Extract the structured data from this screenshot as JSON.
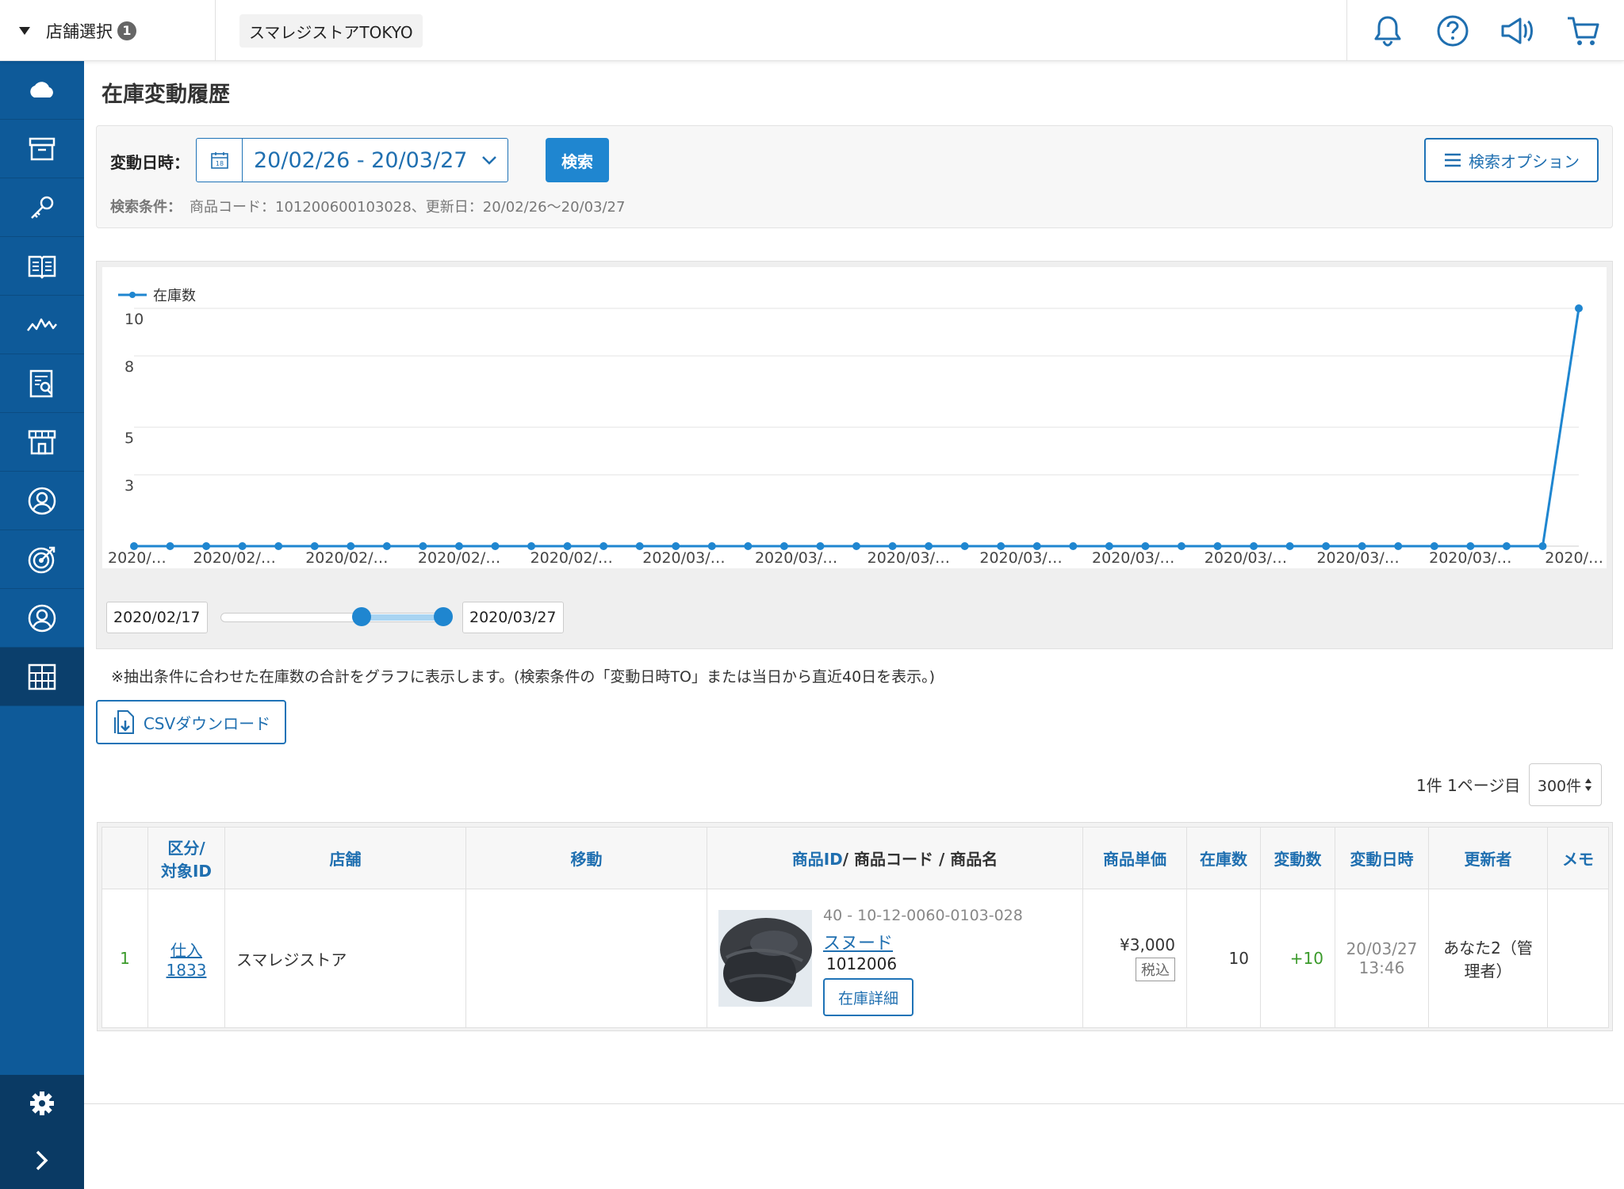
{
  "header": {
    "store_select_label": "店舗選択",
    "store_count": "1",
    "current_store": "スマレジストアTOKYO"
  },
  "page": {
    "title": "在庫変動履歴"
  },
  "search": {
    "date_label": "変動日時：",
    "date_range": "20/02/26 - 20/03/27",
    "search_button": "検索",
    "options_button": "検索オプション",
    "conditions_label": "検索条件：",
    "conditions_text": "商品コード：101200600103028、更新日：20/02/26〜20/03/27"
  },
  "chart_data": {
    "type": "line",
    "legend": [
      "在庫数"
    ],
    "legend_placement": "top-left",
    "grid": true,
    "ylim": [
      0,
      10
    ],
    "yticks": [
      "3",
      "5",
      "8",
      "10"
    ],
    "xtick_labels": [
      "2020/…",
      "2020/02/…",
      "2020/02/…",
      "2020/02/…",
      "2020/02/…",
      "2020/03/…",
      "2020/03/…",
      "2020/03/…",
      "2020/03/…",
      "2020/03/…",
      "2020/03/…",
      "2020/03/…",
      "2020/03/…",
      "2020/…"
    ],
    "series": [
      {
        "name": "在庫数",
        "color": "#1f86d0",
        "values": [
          0,
          0,
          0,
          0,
          0,
          0,
          0,
          0,
          0,
          0,
          0,
          0,
          0,
          0,
          0,
          0,
          0,
          0,
          0,
          0,
          0,
          0,
          0,
          0,
          0,
          0,
          0,
          0,
          0,
          0,
          0,
          0,
          0,
          0,
          0,
          0,
          0,
          0,
          0,
          0,
          10
        ]
      }
    ]
  },
  "range": {
    "from": "2020/02/17",
    "to": "2020/03/27",
    "selected_start_fraction": 0.62,
    "selected_end_fraction": 1.0
  },
  "note": "※抽出条件に合わせた在庫数の合計をグラフに表示します。(検索条件の「変動日時TO」または当日から直近40日を表示。)",
  "csv_button": "CSVダウンロード",
  "pager": {
    "text": "1件 1ページ目",
    "per_page": "300件"
  },
  "table": {
    "headers": {
      "category_line1": "区分/",
      "category_line2": "対象ID",
      "store": "店舗",
      "move": "移動",
      "product_id": "商品ID",
      "product_rest": "/ 商品コード / 商品名",
      "unit_price": "商品単価",
      "stock": "在庫数",
      "change": "変動数",
      "changed_at": "変動日時",
      "updater": "更新者",
      "memo": "メモ"
    },
    "rows": [
      {
        "no": "1",
        "category": "仕入",
        "target_id": "1833",
        "store": "スマレジストア",
        "move": "",
        "product_code": "40 - 10-12-0060-0103-028",
        "product_name": "スヌード",
        "product_number": "1012006",
        "detail_button": "在庫詳細",
        "price": "¥3,000",
        "tax": "税込",
        "stock": "10",
        "change": "+10",
        "date": "20/03/27",
        "time": "13:46",
        "updater": "あなた2（管理者）",
        "memo": ""
      }
    ]
  }
}
